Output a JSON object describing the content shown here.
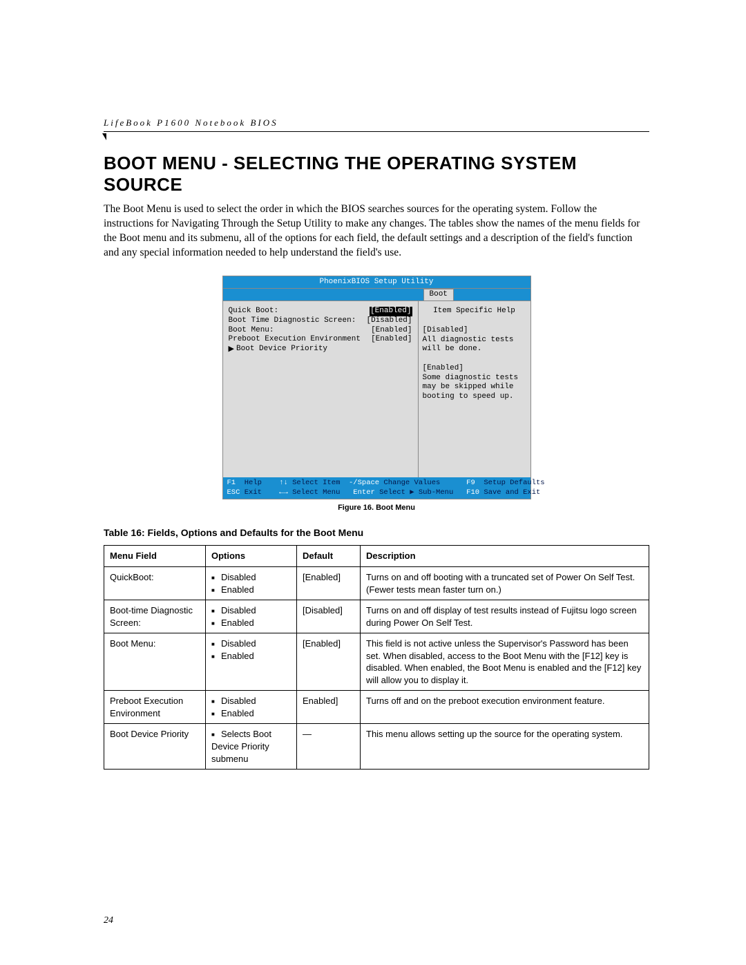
{
  "running_head": "LifeBook P1600 Notebook BIOS",
  "section_title": "BOOT MENU - SELECTING THE OPERATING SYSTEM SOURCE",
  "intro": "The Boot Menu is used to select the order in which the BIOS searches sources for the operating system. Follow the instructions for Navigating Through the Setup Utility to make any changes. The tables show the names of the menu fields for the Boot menu and its submenu, all of the options for each field, the default settings and a description of the field's function and any special information needed to help understand the field's use.",
  "bios": {
    "title": "PhoenixBIOS Setup Utility",
    "tab": "Boot",
    "rows": [
      {
        "label": "Quick Boot:",
        "value": "[Enabled]",
        "selected": true
      },
      {
        "label": "Boot Time Diagnostic Screen:",
        "value": "[Disabled]",
        "selected": false
      },
      {
        "label": "Boot Menu:",
        "value": "[Enabled]",
        "selected": false
      },
      {
        "label": "Preboot Execution Environment",
        "value": "[Enabled]",
        "selected": false
      }
    ],
    "submenu": "Boot Device Priority",
    "help_title": "Item Specific Help",
    "help_body": "[Disabled]\nAll diagnostic tests\nwill be done.\n\n[Enabled]\nSome diagnostic tests\nmay be skipped while\nbooting to speed up.",
    "footer_l1_a": "F1",
    "footer_l1_b": "Help",
    "footer_l1_c": "↑↓",
    "footer_l1_d": "Select Item",
    "footer_l1_e": "-/Space",
    "footer_l1_f": "Change Values",
    "footer_l1_g": "F9",
    "footer_l1_h": "Setup Defaults",
    "footer_l2_a": "ESC",
    "footer_l2_b": "Exit",
    "footer_l2_c": "←→",
    "footer_l2_d": "Select Menu",
    "footer_l2_e": "Enter",
    "footer_l2_f": "Select ▶ Sub-Menu",
    "footer_l2_g": "F10",
    "footer_l2_h": "Save and Exit"
  },
  "figure_caption": "Figure 16.  Boot Menu",
  "table_caption": "Table 16: Fields, Options and Defaults for the Boot Menu",
  "table": {
    "headers": [
      "Menu Field",
      "Options",
      "Default",
      "Description"
    ],
    "rows": [
      {
        "field": "QuickBoot:",
        "options": [
          "Disabled",
          "Enabled"
        ],
        "default": "[Enabled]",
        "desc": "Turns on and off booting with a truncated set of Power On Self Test. (Fewer tests mean faster turn on.)"
      },
      {
        "field": "Boot-time Diagnostic Screen:",
        "options": [
          "Disabled",
          "Enabled"
        ],
        "default": "[Disabled]",
        "desc": "Turns on and off display of test results instead of Fujitsu logo screen during Power On Self Test."
      },
      {
        "field": "Boot Menu:",
        "options": [
          "Disabled",
          "Enabled"
        ],
        "default": "[Enabled]",
        "desc": "This field is not active unless the Supervisor's Password has been set. When disabled, access to the Boot Menu with the [F12] key is disabled. When enabled, the Boot Menu is enabled and the [F12] key will allow you to display it."
      },
      {
        "field": "Preboot Execution Environment",
        "options": [
          "Disabled",
          "Enabled"
        ],
        "default": "Enabled]",
        "desc": "Turns off and on the preboot execution environment feature."
      },
      {
        "field": "Boot Device Priority",
        "options_plain": "Selects Boot Device Priority submenu",
        "default": "—",
        "desc": "This menu allows setting up the source for the operating system."
      }
    ]
  },
  "page_number": "24"
}
